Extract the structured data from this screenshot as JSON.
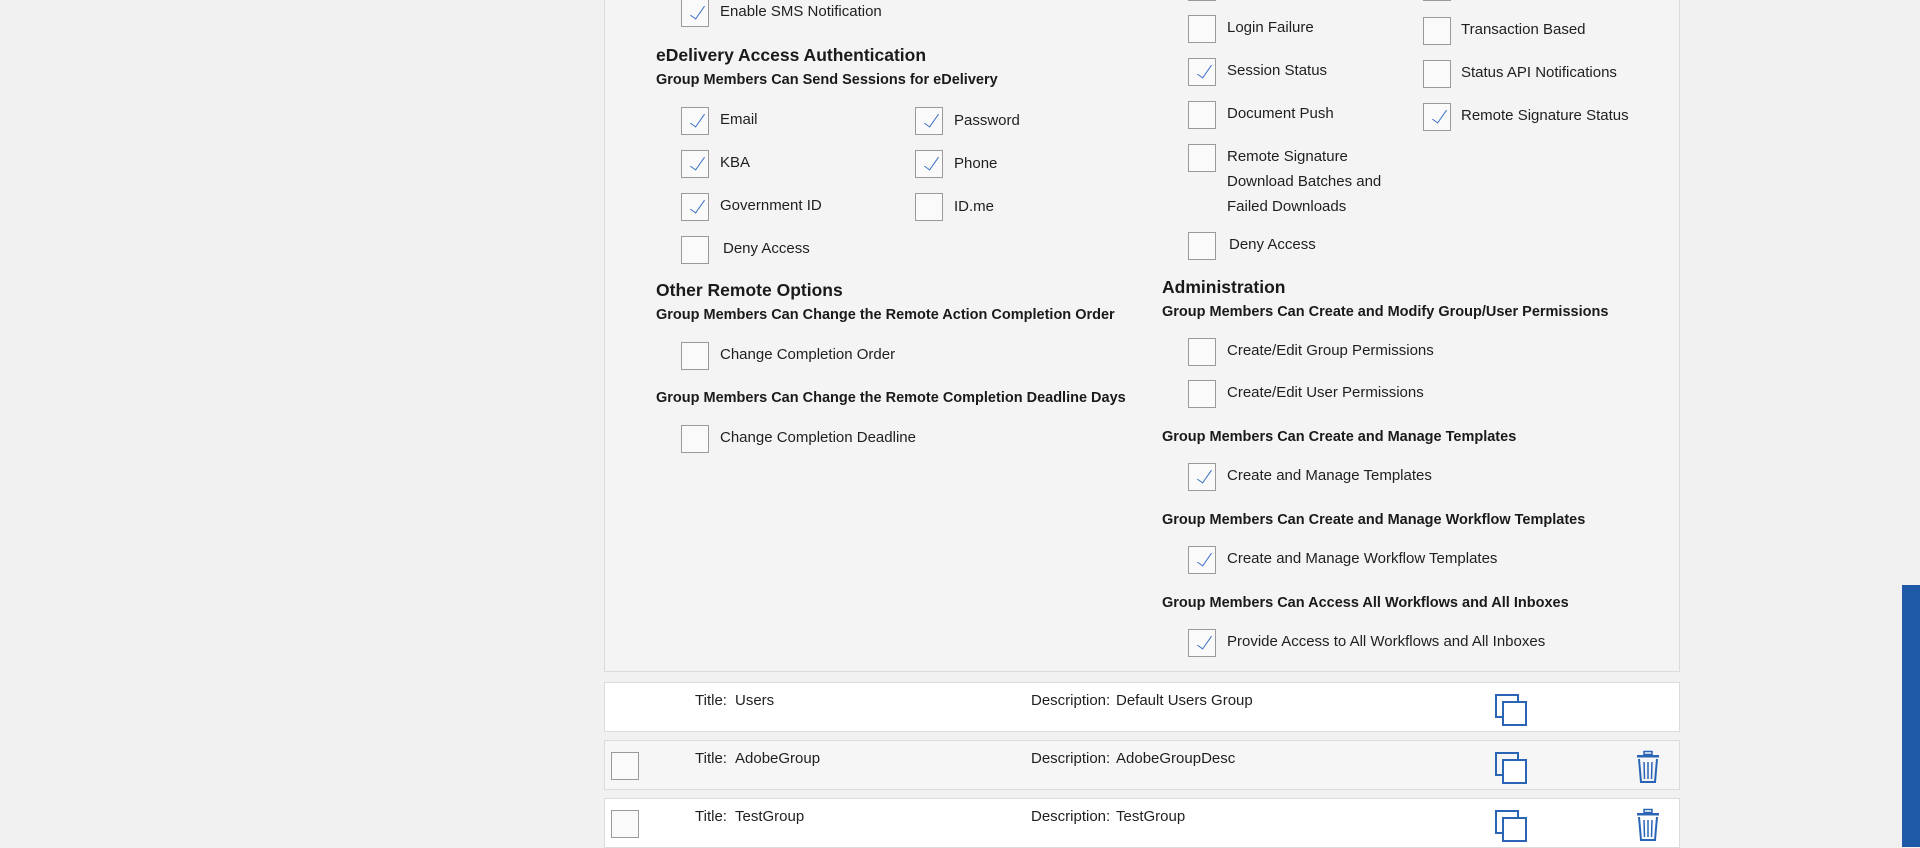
{
  "left_column": {
    "sms": {
      "label": "Enable SMS Notification",
      "checked": true
    },
    "edelivery": {
      "title": "eDelivery Access Authentication",
      "subtitle": "Group Members Can Send Sessions for eDelivery",
      "options": [
        {
          "label": "Email",
          "checked": true
        },
        {
          "label": "Password",
          "checked": true
        },
        {
          "label": "KBA",
          "checked": true
        },
        {
          "label": "Phone",
          "checked": true
        },
        {
          "label": "Government ID",
          "checked": true
        },
        {
          "label": "ID.me",
          "checked": false
        },
        {
          "label": "Deny Access",
          "checked": false
        }
      ]
    },
    "other_remote": {
      "title": "Other Remote Options",
      "order_subtitle": "Group Members Can Change the Remote Action Completion Order",
      "order_option": {
        "label": "Change Completion Order",
        "checked": false
      },
      "deadline_subtitle": "Group Members Can Change the Remote Completion Deadline Days",
      "deadline_option": {
        "label": "Change Completion Deadline",
        "checked": false
      }
    }
  },
  "right_column": {
    "notifications": {
      "col1": [
        {
          "label": "Login Failure",
          "checked": false
        },
        {
          "label": "Session Status",
          "checked": true
        },
        {
          "label": "Document Push",
          "checked": false
        },
        {
          "label": "Remote Signature Download Batches and Failed Downloads",
          "checked": false
        },
        {
          "label": "Deny Access",
          "checked": false
        }
      ],
      "col2": [
        {
          "label": "Transaction Based",
          "checked": false
        },
        {
          "label": "Status API Notifications",
          "checked": false
        },
        {
          "label": "Remote Signature Status",
          "checked": true
        }
      ]
    },
    "administration": {
      "title": "Administration",
      "perm_subtitle": "Group Members Can Create and Modify Group/User Permissions",
      "perm_options": [
        {
          "label": "Create/Edit Group Permissions",
          "checked": false
        },
        {
          "label": "Create/Edit User Permissions",
          "checked": false
        }
      ],
      "templates_subtitle": "Group Members Can Create and Manage Templates",
      "templates_option": {
        "label": "Create and Manage Templates",
        "checked": true
      },
      "workflow_subtitle": "Group Members Can Create and Manage Workflow Templates",
      "workflow_option": {
        "label": "Create and Manage Workflow Templates",
        "checked": true
      },
      "inbox_subtitle": "Group Members Can Access All Workflows and All Inboxes",
      "inbox_option": {
        "label": "Provide Access to All Workflows and All Inboxes",
        "checked": true
      }
    }
  },
  "groups": {
    "title_prefix": "Title:",
    "description_prefix": "Description:",
    "rows": [
      {
        "title": "Users",
        "description": "Default Users Group"
      },
      {
        "title": "AdobeGroup",
        "description": "AdobeGroupDesc"
      },
      {
        "title": "TestGroup",
        "description": "TestGroup"
      }
    ]
  },
  "colors": {
    "accent": "#2a65b5",
    "check": "#3a6fc4",
    "scrollbar": "#1e5aa8"
  },
  "icons": [
    "copy-icon",
    "trash-icon",
    "checkmark-icon"
  ]
}
